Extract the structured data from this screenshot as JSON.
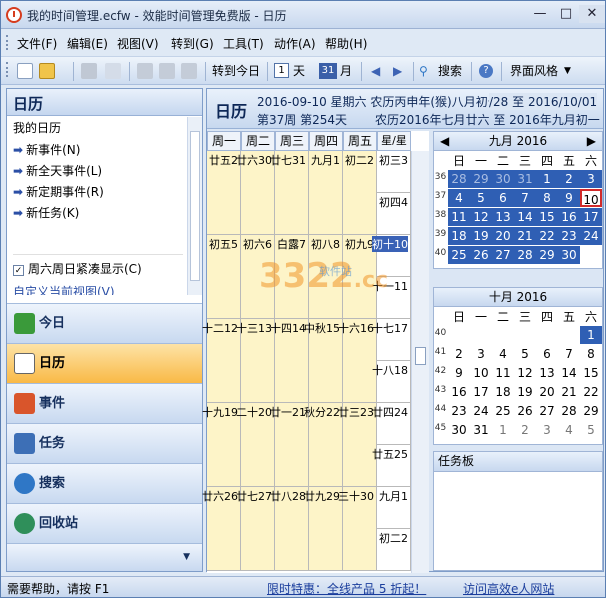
{
  "window": {
    "title": "我的时间管理.ecfw - 效能时间管理免费版 - 日历",
    "min": "—",
    "max": "□",
    "close": "✕"
  },
  "menu": [
    "文件(F)",
    "编辑(E)",
    "视图(V)",
    "转到(G)",
    "工具(T)",
    "动作(A)",
    "帮助(H)"
  ],
  "toolbar": {
    "goto_today": "转到今日",
    "day": "天",
    "day_num": "1",
    "month": "月",
    "month_num": "31",
    "search": "搜索",
    "help": "?",
    "skin": "界面风格"
  },
  "left": {
    "title": "日历",
    "section": "我的日历",
    "actions": [
      "新事件(N)",
      "新全天事件(L)",
      "新定期事件(R)",
      "新任务(K)"
    ],
    "checkbox": "周六周日紧凑显示(C)",
    "custom": "自定义当前视图(V)"
  },
  "nav": [
    {
      "label": "今日",
      "icon": "home-icon",
      "color": "#3a9a3a"
    },
    {
      "label": "日历",
      "icon": "calendar-icon",
      "color": "#c77b17"
    },
    {
      "label": "事件",
      "icon": "event-icon",
      "color": "#d9552b"
    },
    {
      "label": "任务",
      "icon": "task-icon",
      "color": "#3d6fb6"
    },
    {
      "label": "搜索",
      "icon": "search-icon",
      "color": "#2f77c6"
    },
    {
      "label": "回收站",
      "icon": "recycle-icon",
      "color": "#2f8f5a"
    }
  ],
  "main": {
    "title": "日历",
    "line1": "2016-09-10 星期六 农历丙申年(猴)八月初十",
    "line1b": "/28 至 2016/10/01",
    "line2": "第37周 第254天",
    "line2b": "农历2016年七月廿六 至 2016年九月初一"
  },
  "weekdays": [
    "周一",
    "周二",
    "周三",
    "周四",
    "周五",
    "星/星"
  ],
  "weeks": [
    [
      "廿五2",
      "廿六30",
      "廿七31",
      "九月1",
      "初二2",
      "初三3"
    ],
    [
      "初五5",
      "初六6",
      "白露7",
      "初八8",
      "初九9",
      "初十10"
    ],
    [
      "十二12",
      "十三13",
      "十四14",
      "中秋15",
      "十六16",
      "十七17"
    ],
    [
      "十九19",
      "二十20",
      "廿一21",
      "秋分22",
      "廿三23",
      "廿四24"
    ],
    [
      "廿六26",
      "廿七27",
      "廿八28",
      "廿九29",
      "三十30",
      "九月1"
    ]
  ],
  "weekend_sun": [
    "初四4",
    "十一11",
    "十八18",
    "廿五25",
    "初二2"
  ],
  "mini1": {
    "title": "九月 2016",
    "weekheads": [
      "日",
      "一",
      "二",
      "三",
      "四",
      "五",
      "六"
    ],
    "weeknums": [
      "36",
      "37",
      "38",
      "39",
      "40"
    ],
    "rows": [
      [
        "28",
        "29",
        "30",
        "31",
        "1",
        "2",
        "3"
      ],
      [
        "4",
        "5",
        "6",
        "7",
        "8",
        "9",
        "10"
      ],
      [
        "11",
        "12",
        "13",
        "14",
        "15",
        "16",
        "17"
      ],
      [
        "18",
        "19",
        "20",
        "21",
        "22",
        "23",
        "24"
      ],
      [
        "25",
        "26",
        "27",
        "28",
        "29",
        "30",
        ""
      ]
    ]
  },
  "mini2": {
    "title": "十月 2016",
    "weekheads": [
      "日",
      "一",
      "二",
      "三",
      "四",
      "五",
      "六"
    ],
    "weeknums": [
      "40",
      "41",
      "42",
      "43",
      "44",
      "45"
    ],
    "rows": [
      [
        "",
        "",
        "",
        "",
        "",
        "",
        "1"
      ],
      [
        "2",
        "3",
        "4",
        "5",
        "6",
        "7",
        "8"
      ],
      [
        "9",
        "10",
        "11",
        "12",
        "13",
        "14",
        "15"
      ],
      [
        "16",
        "17",
        "18",
        "19",
        "20",
        "21",
        "22"
      ],
      [
        "23",
        "24",
        "25",
        "26",
        "27",
        "28",
        "29"
      ],
      [
        "30",
        "31",
        "1",
        "2",
        "3",
        "4",
        "5"
      ]
    ]
  },
  "taskpane": "任务板",
  "status": {
    "help": "需要帮助，请按 F1",
    "promo": "限时特惠：全线产品 5 折起！",
    "site": "访问高效e人网站"
  },
  "watermark": {
    "main": "3322",
    "sub": "软件站",
    "cc": ".cc"
  },
  "colors": {
    "selected": "#2f5fb4",
    "today_border": "#d12a2a",
    "active_nav": "#f9b946",
    "cell": "#fdf4c8"
  }
}
